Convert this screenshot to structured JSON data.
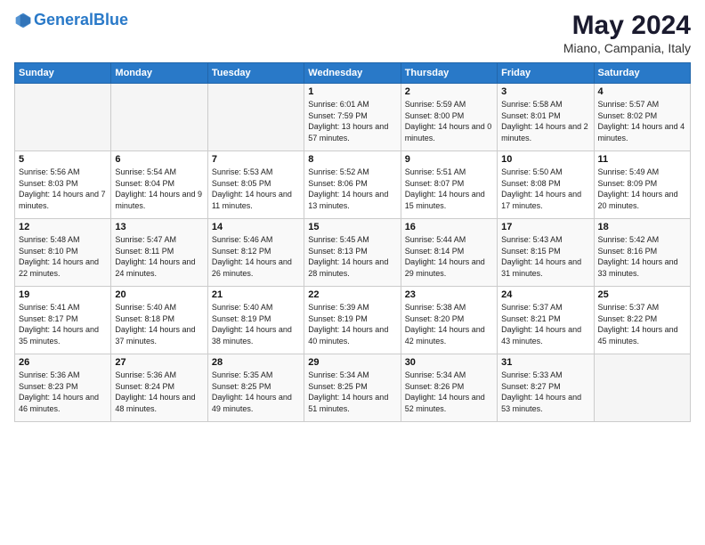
{
  "header": {
    "logo_general": "General",
    "logo_blue": "Blue",
    "month_title": "May 2024",
    "location": "Miano, Campania, Italy"
  },
  "weekdays": [
    "Sunday",
    "Monday",
    "Tuesday",
    "Wednesday",
    "Thursday",
    "Friday",
    "Saturday"
  ],
  "weeks": [
    [
      {
        "day": "",
        "sunrise": "",
        "sunset": "",
        "daylight": ""
      },
      {
        "day": "",
        "sunrise": "",
        "sunset": "",
        "daylight": ""
      },
      {
        "day": "",
        "sunrise": "",
        "sunset": "",
        "daylight": ""
      },
      {
        "day": "1",
        "sunrise": "Sunrise: 6:01 AM",
        "sunset": "Sunset: 7:59 PM",
        "daylight": "Daylight: 13 hours and 57 minutes."
      },
      {
        "day": "2",
        "sunrise": "Sunrise: 5:59 AM",
        "sunset": "Sunset: 8:00 PM",
        "daylight": "Daylight: 14 hours and 0 minutes."
      },
      {
        "day": "3",
        "sunrise": "Sunrise: 5:58 AM",
        "sunset": "Sunset: 8:01 PM",
        "daylight": "Daylight: 14 hours and 2 minutes."
      },
      {
        "day": "4",
        "sunrise": "Sunrise: 5:57 AM",
        "sunset": "Sunset: 8:02 PM",
        "daylight": "Daylight: 14 hours and 4 minutes."
      }
    ],
    [
      {
        "day": "5",
        "sunrise": "Sunrise: 5:56 AM",
        "sunset": "Sunset: 8:03 PM",
        "daylight": "Daylight: 14 hours and 7 minutes."
      },
      {
        "day": "6",
        "sunrise": "Sunrise: 5:54 AM",
        "sunset": "Sunset: 8:04 PM",
        "daylight": "Daylight: 14 hours and 9 minutes."
      },
      {
        "day": "7",
        "sunrise": "Sunrise: 5:53 AM",
        "sunset": "Sunset: 8:05 PM",
        "daylight": "Daylight: 14 hours and 11 minutes."
      },
      {
        "day": "8",
        "sunrise": "Sunrise: 5:52 AM",
        "sunset": "Sunset: 8:06 PM",
        "daylight": "Daylight: 14 hours and 13 minutes."
      },
      {
        "day": "9",
        "sunrise": "Sunrise: 5:51 AM",
        "sunset": "Sunset: 8:07 PM",
        "daylight": "Daylight: 14 hours and 15 minutes."
      },
      {
        "day": "10",
        "sunrise": "Sunrise: 5:50 AM",
        "sunset": "Sunset: 8:08 PM",
        "daylight": "Daylight: 14 hours and 17 minutes."
      },
      {
        "day": "11",
        "sunrise": "Sunrise: 5:49 AM",
        "sunset": "Sunset: 8:09 PM",
        "daylight": "Daylight: 14 hours and 20 minutes."
      }
    ],
    [
      {
        "day": "12",
        "sunrise": "Sunrise: 5:48 AM",
        "sunset": "Sunset: 8:10 PM",
        "daylight": "Daylight: 14 hours and 22 minutes."
      },
      {
        "day": "13",
        "sunrise": "Sunrise: 5:47 AM",
        "sunset": "Sunset: 8:11 PM",
        "daylight": "Daylight: 14 hours and 24 minutes."
      },
      {
        "day": "14",
        "sunrise": "Sunrise: 5:46 AM",
        "sunset": "Sunset: 8:12 PM",
        "daylight": "Daylight: 14 hours and 26 minutes."
      },
      {
        "day": "15",
        "sunrise": "Sunrise: 5:45 AM",
        "sunset": "Sunset: 8:13 PM",
        "daylight": "Daylight: 14 hours and 28 minutes."
      },
      {
        "day": "16",
        "sunrise": "Sunrise: 5:44 AM",
        "sunset": "Sunset: 8:14 PM",
        "daylight": "Daylight: 14 hours and 29 minutes."
      },
      {
        "day": "17",
        "sunrise": "Sunrise: 5:43 AM",
        "sunset": "Sunset: 8:15 PM",
        "daylight": "Daylight: 14 hours and 31 minutes."
      },
      {
        "day": "18",
        "sunrise": "Sunrise: 5:42 AM",
        "sunset": "Sunset: 8:16 PM",
        "daylight": "Daylight: 14 hours and 33 minutes."
      }
    ],
    [
      {
        "day": "19",
        "sunrise": "Sunrise: 5:41 AM",
        "sunset": "Sunset: 8:17 PM",
        "daylight": "Daylight: 14 hours and 35 minutes."
      },
      {
        "day": "20",
        "sunrise": "Sunrise: 5:40 AM",
        "sunset": "Sunset: 8:18 PM",
        "daylight": "Daylight: 14 hours and 37 minutes."
      },
      {
        "day": "21",
        "sunrise": "Sunrise: 5:40 AM",
        "sunset": "Sunset: 8:19 PM",
        "daylight": "Daylight: 14 hours and 38 minutes."
      },
      {
        "day": "22",
        "sunrise": "Sunrise: 5:39 AM",
        "sunset": "Sunset: 8:19 PM",
        "daylight": "Daylight: 14 hours and 40 minutes."
      },
      {
        "day": "23",
        "sunrise": "Sunrise: 5:38 AM",
        "sunset": "Sunset: 8:20 PM",
        "daylight": "Daylight: 14 hours and 42 minutes."
      },
      {
        "day": "24",
        "sunrise": "Sunrise: 5:37 AM",
        "sunset": "Sunset: 8:21 PM",
        "daylight": "Daylight: 14 hours and 43 minutes."
      },
      {
        "day": "25",
        "sunrise": "Sunrise: 5:37 AM",
        "sunset": "Sunset: 8:22 PM",
        "daylight": "Daylight: 14 hours and 45 minutes."
      }
    ],
    [
      {
        "day": "26",
        "sunrise": "Sunrise: 5:36 AM",
        "sunset": "Sunset: 8:23 PM",
        "daylight": "Daylight: 14 hours and 46 minutes."
      },
      {
        "day": "27",
        "sunrise": "Sunrise: 5:36 AM",
        "sunset": "Sunset: 8:24 PM",
        "daylight": "Daylight: 14 hours and 48 minutes."
      },
      {
        "day": "28",
        "sunrise": "Sunrise: 5:35 AM",
        "sunset": "Sunset: 8:25 PM",
        "daylight": "Daylight: 14 hours and 49 minutes."
      },
      {
        "day": "29",
        "sunrise": "Sunrise: 5:34 AM",
        "sunset": "Sunset: 8:25 PM",
        "daylight": "Daylight: 14 hours and 51 minutes."
      },
      {
        "day": "30",
        "sunrise": "Sunrise: 5:34 AM",
        "sunset": "Sunset: 8:26 PM",
        "daylight": "Daylight: 14 hours and 52 minutes."
      },
      {
        "day": "31",
        "sunrise": "Sunrise: 5:33 AM",
        "sunset": "Sunset: 8:27 PM",
        "daylight": "Daylight: 14 hours and 53 minutes."
      },
      {
        "day": "",
        "sunrise": "",
        "sunset": "",
        "daylight": ""
      }
    ]
  ]
}
